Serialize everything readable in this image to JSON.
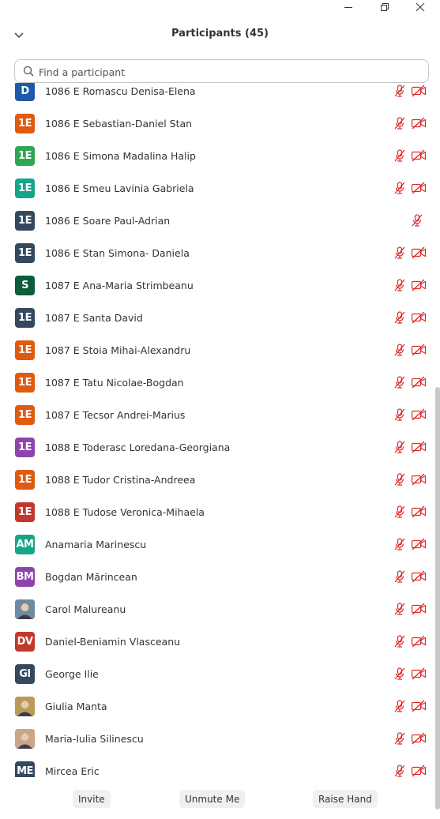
{
  "window_controls": [
    "minimize",
    "maximize",
    "close"
  ],
  "header": {
    "title": "Participants (45)"
  },
  "search": {
    "placeholder": "Find a participant",
    "value": ""
  },
  "participants": [
    {
      "initials": "D",
      "name": "1086 E Romascu Denisa-Elena",
      "avatar_color": "#1e5aa8",
      "mic": "muted",
      "video": "off"
    },
    {
      "initials": "1E",
      "name": "1086 E Sebastian-Daniel Stan",
      "avatar_color": "#e05a10",
      "mic": "muted",
      "video": "off"
    },
    {
      "initials": "1E",
      "name": "1086 E Simona Madalina Halip",
      "avatar_color": "#2fa656",
      "mic": "muted",
      "video": "off"
    },
    {
      "initials": "1E",
      "name": "1086 E Smeu Lavinia Gabriela",
      "avatar_color": "#17a589",
      "mic": "muted",
      "video": "off"
    },
    {
      "initials": "1E",
      "name": "1086 E Soare Paul-Adrian",
      "avatar_color": "#34495e",
      "mic": "muted",
      "video": "none"
    },
    {
      "initials": "1E",
      "name": "1086 E Stan Simona- Daniela",
      "avatar_color": "#34495e",
      "mic": "muted",
      "video": "off"
    },
    {
      "initials": "S",
      "name": "1087 E Ana-Maria Strimbeanu",
      "avatar_color": "#0e5c3a",
      "mic": "muted",
      "video": "off"
    },
    {
      "initials": "1E",
      "name": "1087 E Santa David",
      "avatar_color": "#34495e",
      "mic": "muted",
      "video": "off"
    },
    {
      "initials": "1E",
      "name": "1087 E Stoia Mihai-Alexandru",
      "avatar_color": "#e05a10",
      "mic": "muted",
      "video": "off"
    },
    {
      "initials": "1E",
      "name": "1087 E Tatu Nicolae-Bogdan",
      "avatar_color": "#e05a10",
      "mic": "muted",
      "video": "off"
    },
    {
      "initials": "1E",
      "name": "1087 E Tecsor Andrei-Marius",
      "avatar_color": "#e05a10",
      "mic": "muted",
      "video": "off"
    },
    {
      "initials": "1E",
      "name": "1088 E Toderasc Loredana-Georgiana",
      "avatar_color": "#8e44ad",
      "mic": "muted",
      "video": "off"
    },
    {
      "initials": "1E",
      "name": "1088 E Tudor Cristina-Andreea",
      "avatar_color": "#e05a10",
      "mic": "muted",
      "video": "off"
    },
    {
      "initials": "1E",
      "name": "1088 E Tudose Veronica-Mihaela",
      "avatar_color": "#c0392b",
      "mic": "muted",
      "video": "off"
    },
    {
      "initials": "AM",
      "name": "Anamaria Marinescu",
      "avatar_color": "#17a589",
      "mic": "muted",
      "video": "off"
    },
    {
      "initials": "BM",
      "name": "Bogdan Mărincean",
      "avatar_color": "#8e44ad",
      "mic": "muted",
      "video": "off"
    },
    {
      "initials": "",
      "name": "Carol Malureanu",
      "avatar_color": "#6f8aa0",
      "photo": true,
      "mic": "muted",
      "video": "off"
    },
    {
      "initials": "DV",
      "name": "Daniel-Beniamin Vlasceanu",
      "avatar_color": "#c0392b",
      "mic": "muted",
      "video": "off"
    },
    {
      "initials": "GI",
      "name": "George Ilie",
      "avatar_color": "#34495e",
      "mic": "muted",
      "video": "off"
    },
    {
      "initials": "",
      "name": "Giulia Manta",
      "avatar_color": "#b89a5a",
      "photo": true,
      "mic": "muted",
      "video": "off"
    },
    {
      "initials": "",
      "name": "Maria-Iulia Silinescu",
      "avatar_color": "#c9a58a",
      "photo": true,
      "mic": "muted",
      "video": "off"
    },
    {
      "initials": "ME",
      "name": "Mircea Eric",
      "avatar_color": "#34495e",
      "mic": "muted",
      "video": "off"
    }
  ],
  "footer": {
    "invite_label": "Invite",
    "unmute_label": "Unmute Me",
    "raise_hand_label": "Raise Hand"
  },
  "colors": {
    "muted_icon": "#e02828"
  }
}
